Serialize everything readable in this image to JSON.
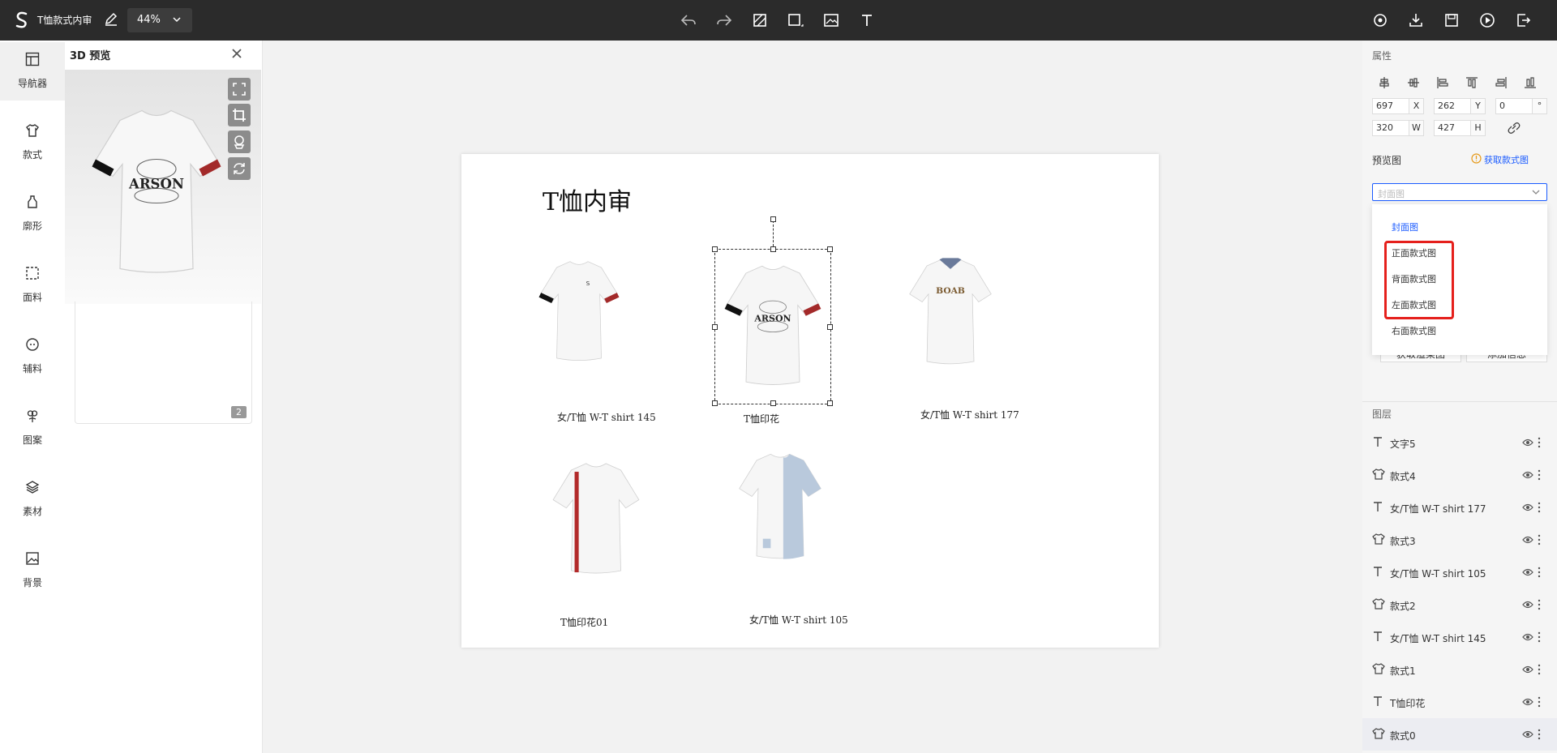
{
  "app": {
    "title": "T恤款式内审",
    "zoom": "44%"
  },
  "toolbar": {
    "center_icons": [
      "undo-icon",
      "redo-icon",
      "mask-icon",
      "rectangle-icon",
      "image-icon",
      "text-icon"
    ],
    "right_icons": [
      "preview-icon",
      "download-icon",
      "save-icon",
      "play-icon",
      "exit-icon"
    ]
  },
  "nav": {
    "items": [
      {
        "label": "导航器",
        "icon": "navigator-icon"
      },
      {
        "label": "款式",
        "icon": "tshirt-icon"
      },
      {
        "label": "廓形",
        "icon": "silhouette-icon"
      },
      {
        "label": "面料",
        "icon": "fabric-icon"
      },
      {
        "label": "辅料",
        "icon": "button-icon"
      },
      {
        "label": "图案",
        "icon": "pattern-icon"
      },
      {
        "label": "素材",
        "icon": "layers-icon"
      },
      {
        "label": "背景",
        "icon": "background-icon"
      }
    ]
  },
  "preview3d": {
    "title": "3D 预览",
    "print_text": "ARSON",
    "page_badge": "2"
  },
  "canvas": {
    "title": "T恤内审",
    "items": [
      {
        "label": "女/T恤 W-T shirt 145"
      },
      {
        "label": "T恤印花",
        "print": "ARSON"
      },
      {
        "label": "女/T恤 W-T shirt 177",
        "print": "BOAB"
      },
      {
        "label": "T恤印花01"
      },
      {
        "label": "女/T恤 W-T shirt 105"
      }
    ]
  },
  "properties": {
    "section_title": "属性",
    "x": "697",
    "x_unit": "X",
    "y": "262",
    "y_unit": "Y",
    "rotation": "0",
    "rotation_unit": "°",
    "w": "320",
    "w_unit": "W",
    "h": "427",
    "h_unit": "H"
  },
  "preview_image": {
    "label": "预览图",
    "get_link": "获取款式图",
    "select_placeholder": "封面图",
    "options": [
      "封面图",
      "正面款式图",
      "背面款式图",
      "左面款式图",
      "右面款式图"
    ],
    "selected": "封面图",
    "buttons": [
      "获取渲染图",
      "添加信息"
    ]
  },
  "layers": {
    "title": "图层",
    "items": [
      {
        "type": "text",
        "name": "文字5"
      },
      {
        "type": "style",
        "name": "款式4"
      },
      {
        "type": "text",
        "name": "女/T恤 W-T shirt 177"
      },
      {
        "type": "style",
        "name": "款式3"
      },
      {
        "type": "text",
        "name": "女/T恤 W-T shirt 105"
      },
      {
        "type": "style",
        "name": "款式2"
      },
      {
        "type": "text",
        "name": "女/T恤 W-T shirt 145"
      },
      {
        "type": "style",
        "name": "款式1"
      },
      {
        "type": "text",
        "name": "T恤印花"
      },
      {
        "type": "style",
        "name": "款式0"
      }
    ]
  },
  "colors": {
    "accent": "#1a5bff",
    "topbar": "#2b2b2b",
    "highlight": "#e5201c"
  }
}
